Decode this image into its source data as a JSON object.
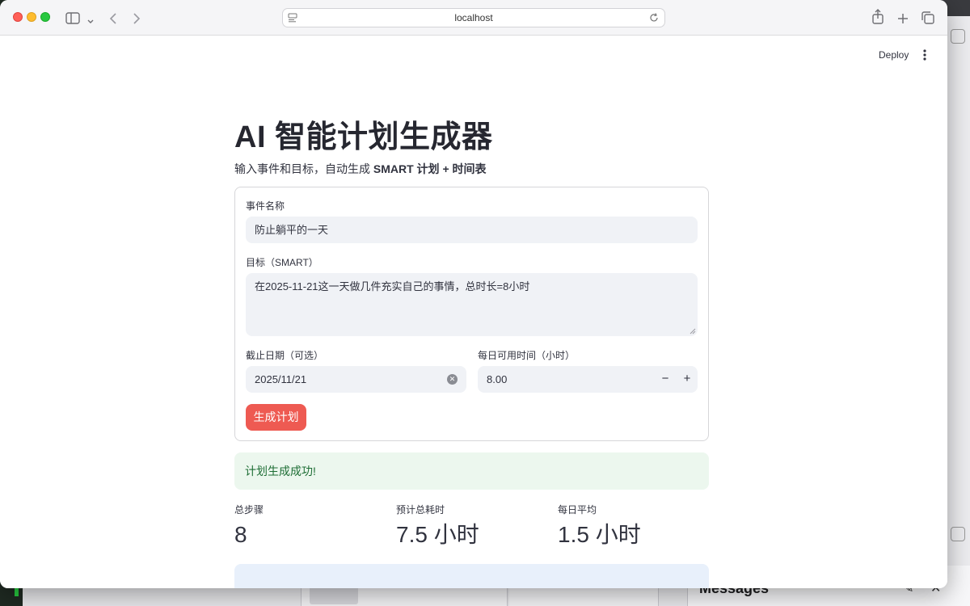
{
  "browser": {
    "url": "localhost"
  },
  "app": {
    "deploy_label": "Deploy",
    "title": "AI 智能计划生成器",
    "subtitle_prefix": "输入事件和目标，自动生成 ",
    "subtitle_bold": "SMART 计划 + 时间表"
  },
  "form": {
    "event_name_label": "事件名称",
    "event_name_value": "防止躺平的一天",
    "goal_label": "目标（SMART）",
    "goal_value": "在2025-11-21这一天做几件充实自己的事情，总时长=8小时",
    "deadline_label": "截止日期（可选）",
    "deadline_value": "2025/11/21",
    "daily_hours_label": "每日可用时间（小时）",
    "daily_hours_value": "8.00",
    "minus_label": "−",
    "plus_label": "+",
    "submit_label": "生成计划"
  },
  "result": {
    "success_message": "计划生成成功!",
    "metrics": [
      {
        "label": "总步骤",
        "value": "8"
      },
      {
        "label": "预计总耗时",
        "value": "7.5 小时"
      },
      {
        "label": "每日平均",
        "value": "1.5 小时"
      }
    ]
  },
  "background": {
    "messages_title": "Messages"
  },
  "colors": {
    "accent": "#ee5a52",
    "success_bg": "#ecf7ee",
    "success_text": "#1e6e35",
    "input_bg": "#f0f2f6"
  }
}
